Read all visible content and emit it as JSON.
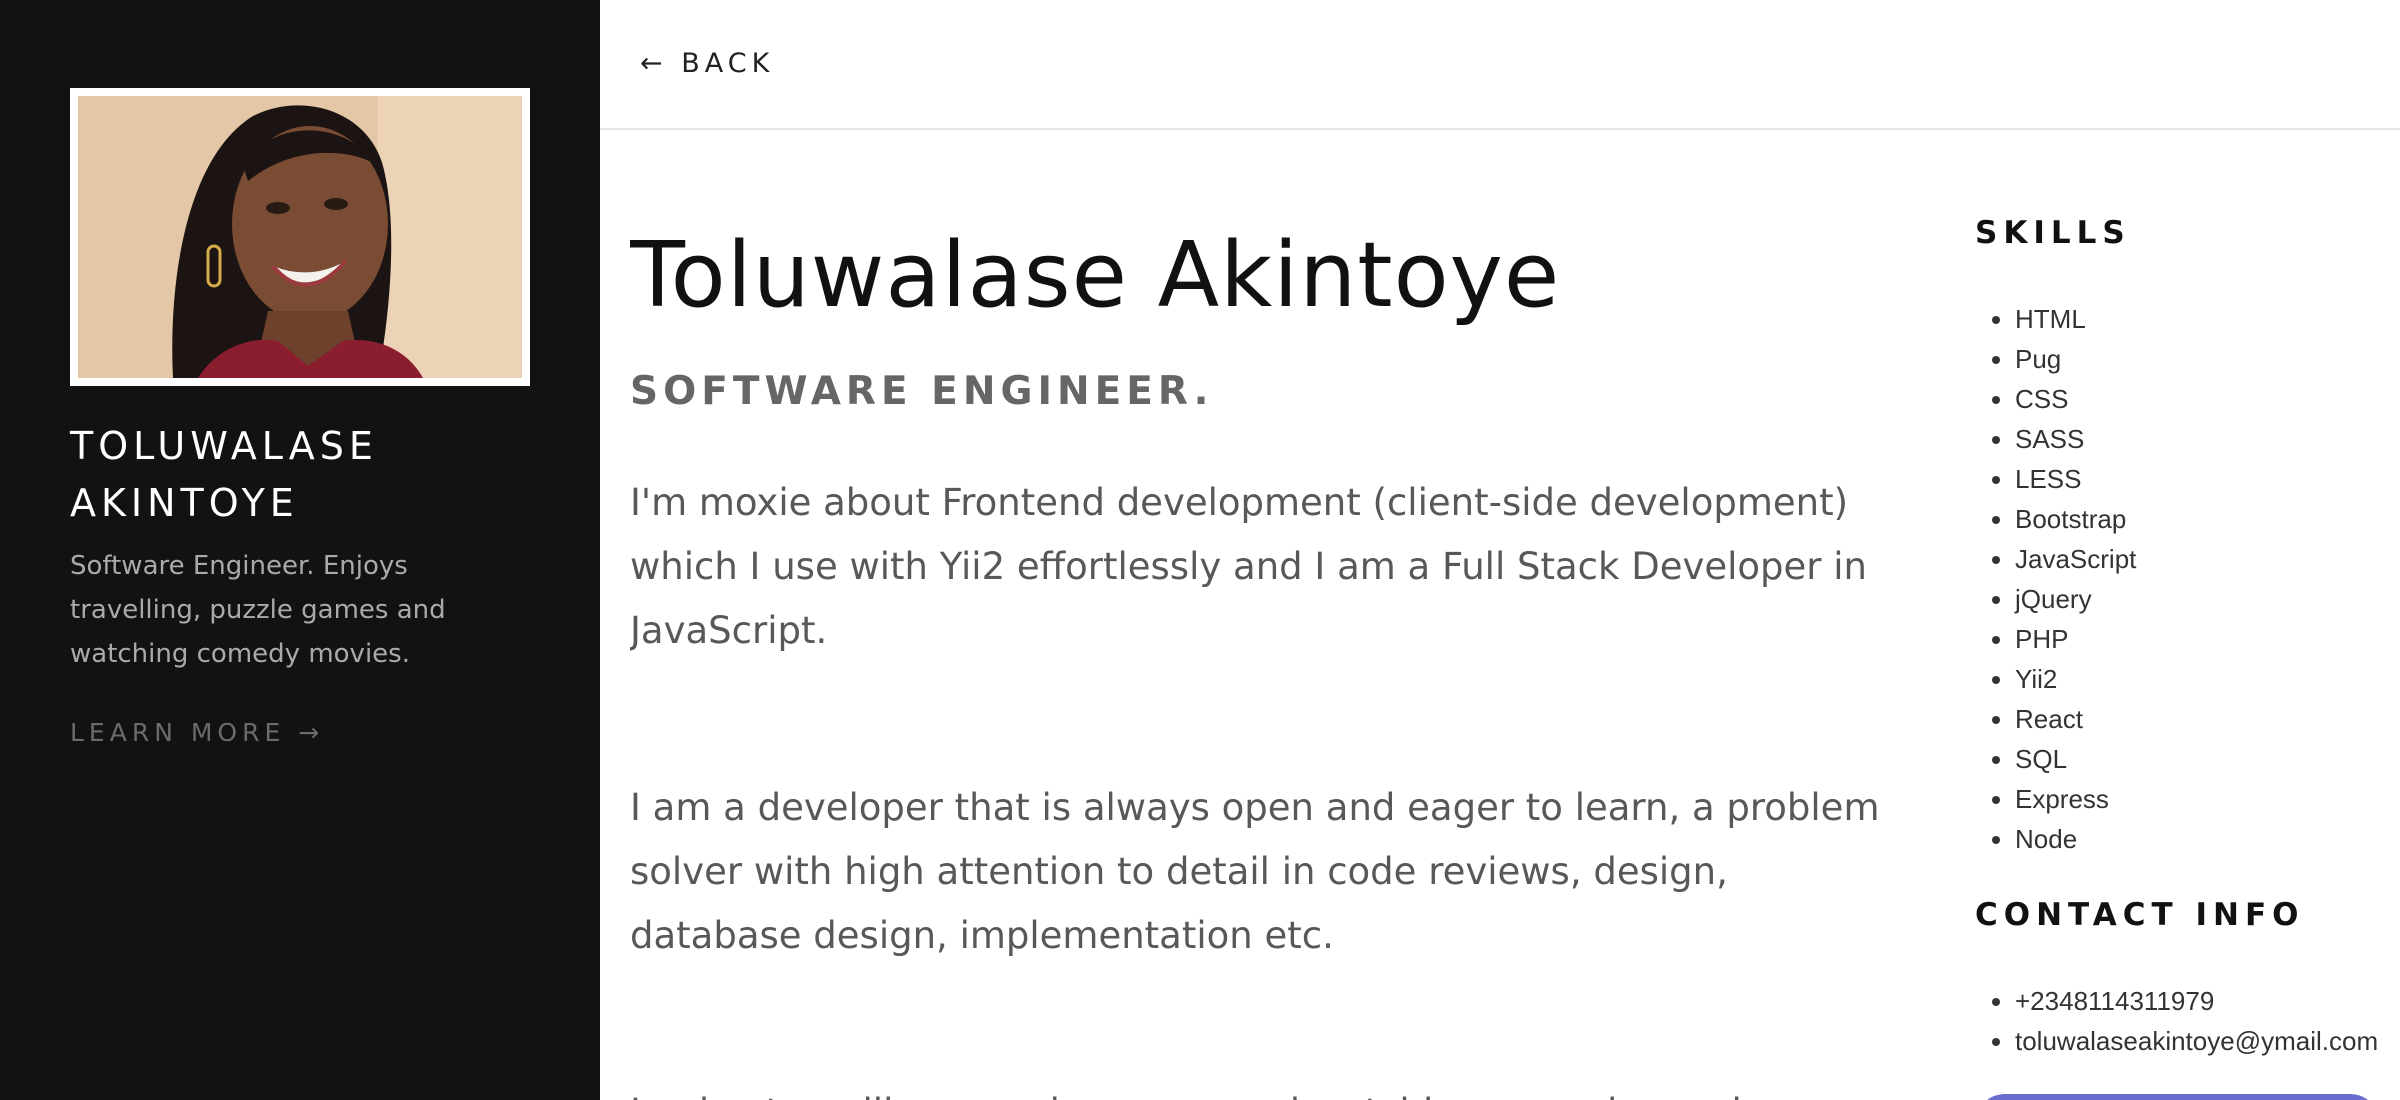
{
  "sidebar": {
    "name_line1": "TOLUWALASE",
    "name_line2": "AKINTOYE",
    "bio": "Software Engineer. Enjoys travelling, puzzle games and watching comedy movies.",
    "learn_more": "LEARN MORE →"
  },
  "header": {
    "back": "← BACK"
  },
  "main": {
    "title": "Toluwalase Akintoye",
    "subtitle": "SOFTWARE ENGINEER.",
    "paragraphs": [
      "I'm moxie about Frontend development (client-side development) which I use with Yii2 effortlessly and I am a Full Stack Developer in JavaScript.",
      "I am a developer that is always open and eager to learn, a problem solver with high attention to detail in code reviews, design, database design, implementation etc.",
      "I enjoy travelling, puzzle games and watching comedy movies."
    ]
  },
  "skills": {
    "title": "SKILLS",
    "items": [
      "HTML",
      "Pug",
      "CSS",
      "SASS",
      "LESS",
      "Bootstrap",
      "JavaScript",
      "jQuery",
      "PHP",
      "Yii2",
      "React",
      "SQL",
      "Express",
      "Node"
    ]
  },
  "contact": {
    "title": "CONTACT INFO",
    "phone": "+2348114311979",
    "email": "toluwalaseakintoye@ymail.com"
  },
  "colors": {
    "sidebar_bg": "#121212",
    "accent_button": "#6a6fcf"
  }
}
